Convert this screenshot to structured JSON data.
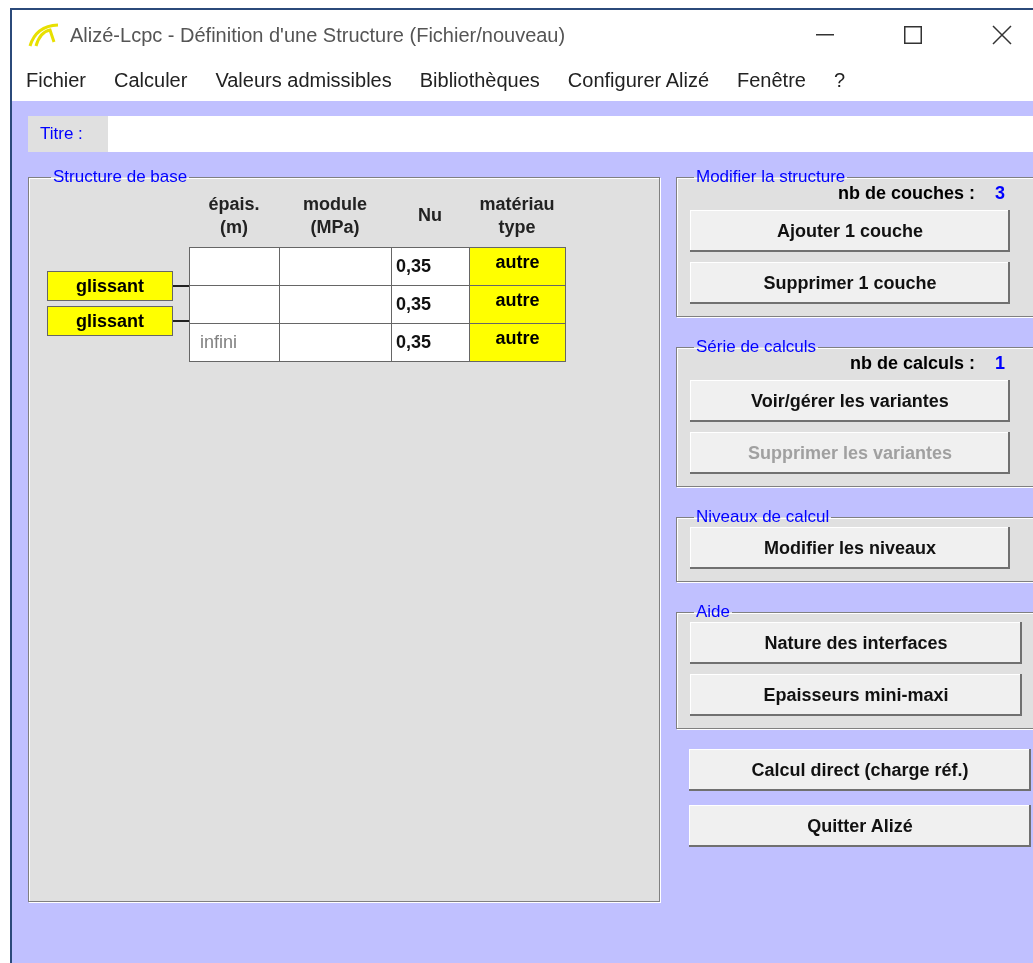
{
  "window": {
    "title": "Alizé-Lcpc - Définition d'une Structure (Fichier/nouveau)"
  },
  "menu": [
    "Fichier",
    "Calculer",
    "Valeurs admissibles",
    "Bibliothèques",
    "Configurer Alizé",
    "Fenêtre",
    "?"
  ],
  "title_field": {
    "label": "Titre :"
  },
  "structure": {
    "title": "Structure de base",
    "columns": [
      {
        "line1": "épais.",
        "line2": "(m)"
      },
      {
        "line1": "module",
        "line2": "(MPa)"
      },
      {
        "line1": "Nu"
      },
      {
        "line1": "matériau",
        "line2": "type"
      }
    ],
    "layers": [
      {
        "nu": "0,35",
        "material": "autre"
      },
      {
        "nu": "0,35",
        "material": "autre"
      },
      {
        "thickness": "infini",
        "nu": "0,35",
        "material": "autre"
      }
    ],
    "interfaces": [
      {
        "label": "glissant"
      },
      {
        "label": "glissant"
      }
    ]
  },
  "groups": [
    {
      "title": "Modifier la structure",
      "count": {
        "label": "nb de couches :",
        "value": "3"
      },
      "buttons": [
        {
          "label": "Ajouter 1 couche",
          "disabled": false
        },
        {
          "label": "Supprimer 1 couche",
          "disabled": false
        }
      ]
    },
    {
      "title": "Série de calculs",
      "count": {
        "label": "nb de calculs :",
        "value": "1"
      },
      "buttons": [
        {
          "label": "Voir/gérer les variantes",
          "disabled": false
        },
        {
          "label": "Supprimer les variantes",
          "disabled": true
        }
      ]
    },
    {
      "title": "Niveaux de calcul",
      "buttons": [
        {
          "label": "Modifier les niveaux",
          "disabled": false
        }
      ]
    },
    {
      "title": "Aide",
      "buttons": [
        {
          "label": "Nature des interfaces",
          "disabled": false
        },
        {
          "label": "Epaisseurs mini-maxi",
          "disabled": false
        }
      ]
    }
  ],
  "actions": [
    {
      "label": "Calcul direct (charge réf.)",
      "disabled": false
    },
    {
      "label": "Quitter Alizé",
      "disabled": false
    }
  ]
}
